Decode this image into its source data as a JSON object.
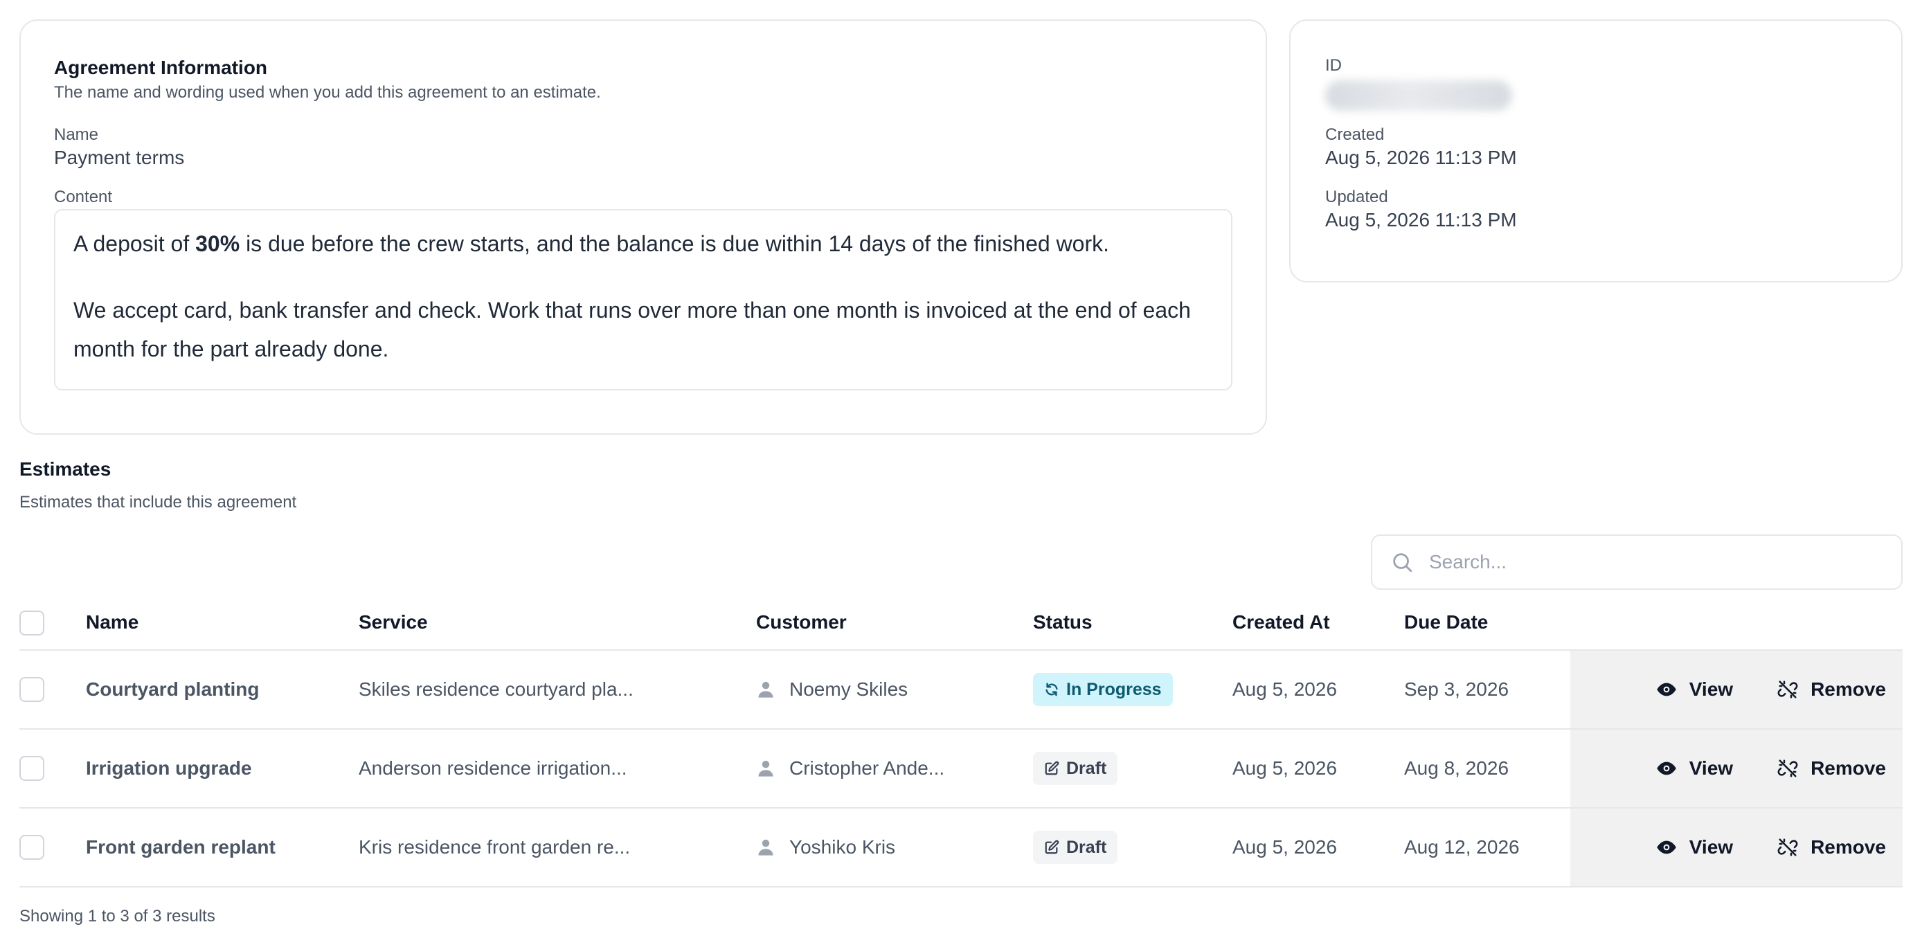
{
  "agreement": {
    "title": "Agreement Information",
    "description": "The name and wording used when you add this agreement to an estimate.",
    "name_label": "Name",
    "name_value": "Payment terms",
    "content_label": "Content",
    "content_p1_before": "A deposit of ",
    "content_p1_bold": "30%",
    "content_p1_after": " is due before the crew starts, and the balance is due within 14 days of the finished work.",
    "content_p2": "We accept card, bank transfer and check. Work that runs over more than one month is invoiced at the end of each month for the part already done."
  },
  "meta": {
    "id_label": "ID",
    "created_label": "Created",
    "created_value": "Aug 5, 2026 11:13 PM",
    "updated_label": "Updated",
    "updated_value": "Aug 5, 2026 11:13 PM"
  },
  "estimates": {
    "title": "Estimates",
    "description": "Estimates that include this agreement",
    "search_placeholder": "Search...",
    "columns": {
      "name": "Name",
      "service": "Service",
      "customer": "Customer",
      "status": "Status",
      "created_at": "Created At",
      "due_date": "Due Date"
    },
    "rows": [
      {
        "name": "Courtyard planting",
        "service": "Skiles residence courtyard pla...",
        "customer": "Noemy Skiles",
        "status": "In Progress",
        "created_at": "Aug 5, 2026",
        "due_date": "Sep 3, 2026",
        "view": "View",
        "remove": "Remove"
      },
      {
        "name": "Irrigation upgrade",
        "service": "Anderson residence irrigation...",
        "customer": "Cristopher Ande...",
        "status": "Draft",
        "created_at": "Aug 5, 2026",
        "due_date": "Aug 8, 2026",
        "view": "View",
        "remove": "Remove"
      },
      {
        "name": "Front garden replant",
        "service": "Kris residence front garden re...",
        "customer": "Yoshiko Kris",
        "status": "Draft",
        "created_at": "Aug 5, 2026",
        "due_date": "Aug 12, 2026",
        "view": "View",
        "remove": "Remove"
      }
    ],
    "footer": "Showing 1 to 3 of 3 results"
  },
  "colors": {
    "in_progress_bg": "#cff4fc",
    "draft_bg": "#f3f4f6",
    "actions_bg": "#f0f1f0"
  }
}
